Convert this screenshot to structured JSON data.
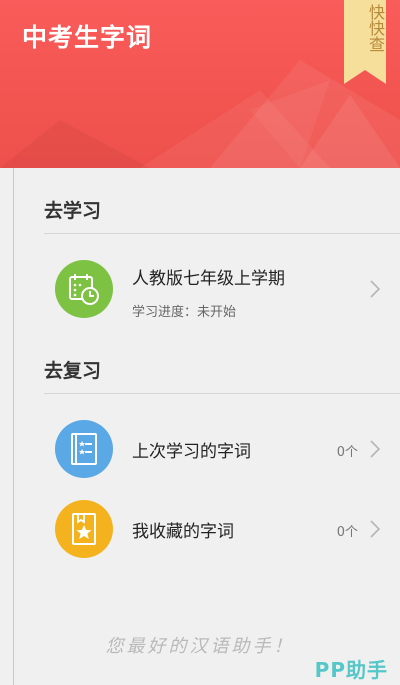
{
  "header": {
    "title": "中考生字词",
    "quick_search": "快快查"
  },
  "study": {
    "section_title": "去学习",
    "item": {
      "label": "人教版七年级上学期",
      "progress": "学习进度：未开始",
      "icon": "calendar-clock-icon"
    }
  },
  "review": {
    "section_title": "去复习",
    "items": [
      {
        "label": "上次学习的字词",
        "count": "0个",
        "icon": "notebook-list-icon"
      },
      {
        "label": "我收藏的字词",
        "count": "0个",
        "icon": "star-book-icon"
      }
    ]
  },
  "footer": {
    "slogan": "您最好的汉语助手！",
    "watermark": "PP助手"
  },
  "colors": {
    "header": "#f25450",
    "study_icon_bg": "#7dc243",
    "review_icon_bg": "#5aa8e6",
    "favorite_icon_bg": "#f5b21f",
    "ribbon": "#f5df9a"
  }
}
